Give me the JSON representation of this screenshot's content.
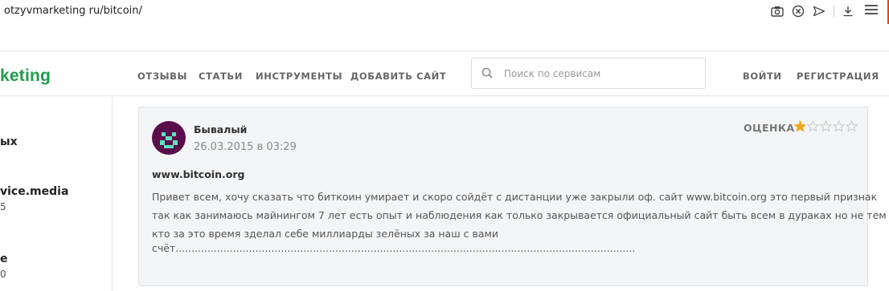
{
  "browser": {
    "url": "otzyvmarketing ru/bitcoin/",
    "icons": [
      "camera-icon",
      "block-icon",
      "send-icon",
      "download-icon",
      "menu-icon"
    ]
  },
  "header": {
    "logo": "keting",
    "nav": [
      "ОТЗЫВЫ",
      "СТАТЬИ",
      "ИНСТРУМЕНТЫ",
      "ДОБАВИТЬ САЙТ"
    ],
    "search_placeholder": "Поиск по сервисам",
    "login": "ВОЙТИ",
    "register": "РЕГИСТРАЦИЯ"
  },
  "sidebar": {
    "items": [
      {
        "text": "ых"
      },
      {
        "text": "vice.media",
        "sub": "5"
      },
      {
        "text": "e",
        "sub": "0"
      }
    ]
  },
  "review": {
    "author": "Бывалый",
    "date": "26.03.2015 в 03:29",
    "rating_label": "ОЦЕНКА",
    "rating": 1,
    "rating_max": 5,
    "site": "www.bitcoin.org",
    "lines": [
      "Привет всем, хочу сказать что биткоин умирает и скоро сойдёт с дистанции уже закрыли оф. сайт www.bitcoin.org это первый признак",
      "так как занимаюсь майнингом 7 лет есть опыт и наблюдения как только закрывается официальный сайт быть всем в дураках но не тем",
      "кто за это время зделал себе миллиарды зелёных за наш с вами",
      "счёт................................................................................................................................................"
    ]
  },
  "colors": {
    "brand_green": "#1e9b4a",
    "star_filled": "#f0a81c",
    "star_empty": "#c8c8c8",
    "avatar_bg": "#5a0d4a",
    "avatar_fg": "#5ee0c0"
  }
}
